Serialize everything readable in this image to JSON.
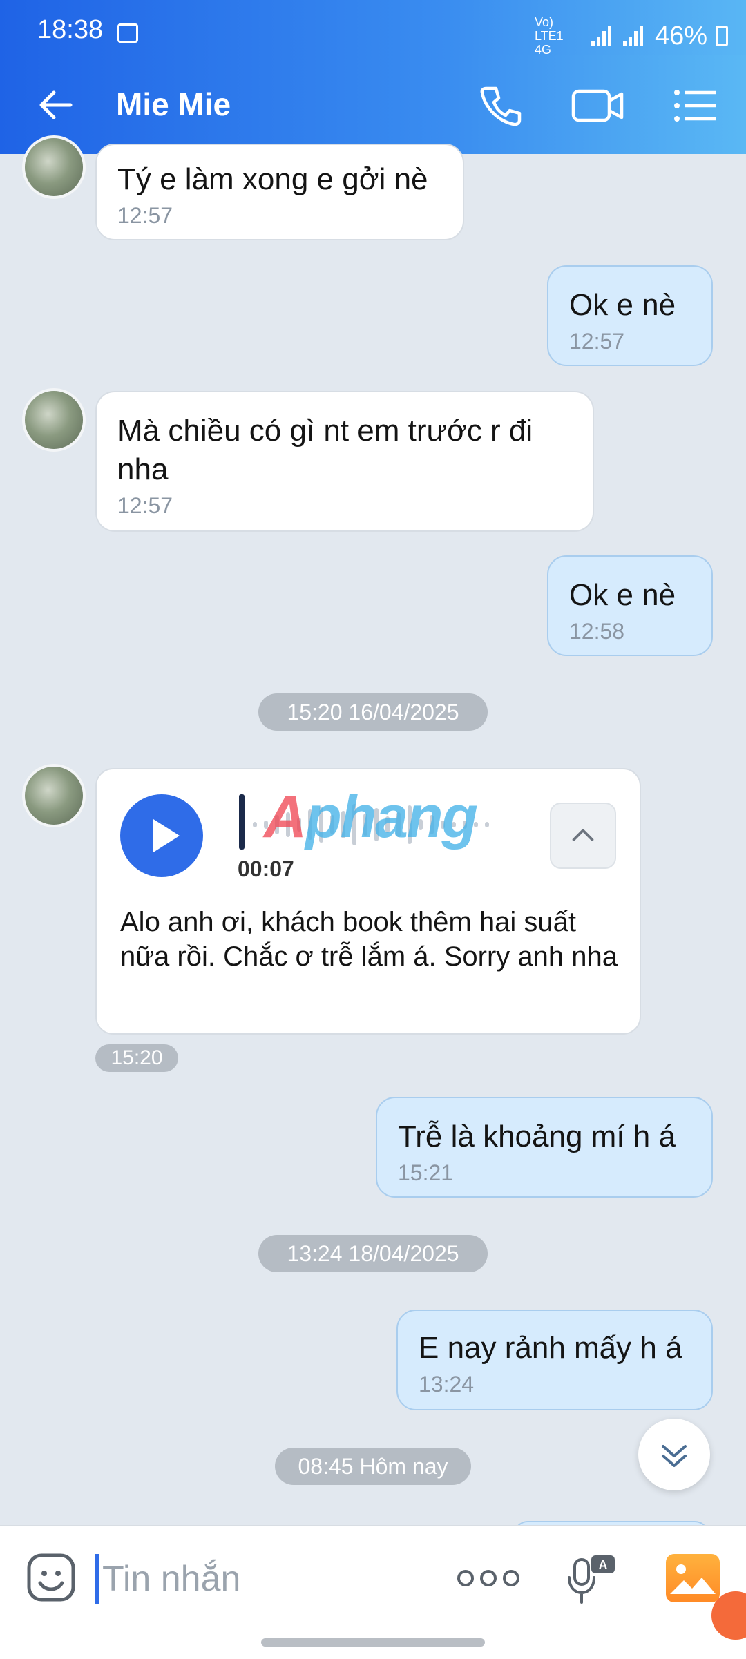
{
  "status_bar": {
    "time": "18:38",
    "network": "Vo) LTE1 4G",
    "battery": "46%"
  },
  "header": {
    "contact_name": "Mie Mie",
    "icons": [
      "back-arrow-icon",
      "phone-icon",
      "video-call-icon",
      "menu-list-icon"
    ]
  },
  "messages": [
    {
      "direction": "in",
      "text": "Tý e làm xong e gởi nè",
      "time": "12:57"
    },
    {
      "direction": "out",
      "text": "Ok e nè",
      "time": "12:57"
    },
    {
      "direction": "in",
      "text": "Mà chiều có gì nt em trước r đi nha",
      "time": "12:57"
    },
    {
      "direction": "out",
      "text": "Ok e nè",
      "time": "12:58"
    }
  ],
  "date_separators": [
    "15:20 16/04/2025",
    "13:24 18/04/2025",
    "08:45 Hôm nay"
  ],
  "voice_message": {
    "duration": "00:07",
    "transcript": "Alo anh ơi, khách book thêm hai suất nữa rồi. Chắc ơ trễ lắm á. Sorry anh nha",
    "time": "15:20",
    "watermark": "Aphang"
  },
  "messages_after": [
    {
      "direction": "out",
      "text": "Trễ là khoảng mí h á",
      "time": "15:21"
    },
    {
      "direction": "out",
      "text": "E nay rảnh mấy h á",
      "time": "13:24"
    }
  ],
  "composer": {
    "placeholder": "Tin nhắn",
    "icons": [
      "emoji-icon",
      "more-dots-icon",
      "voice-to-text-icon",
      "gallery-icon"
    ]
  },
  "colors": {
    "header_start": "#1f63e6",
    "header_end": "#5ab8f4",
    "outgoing_bubble": "#d6ebfd",
    "incoming_bubble": "#ffffff",
    "background": "#e2e8ef",
    "accent": "#2f6ce8"
  }
}
